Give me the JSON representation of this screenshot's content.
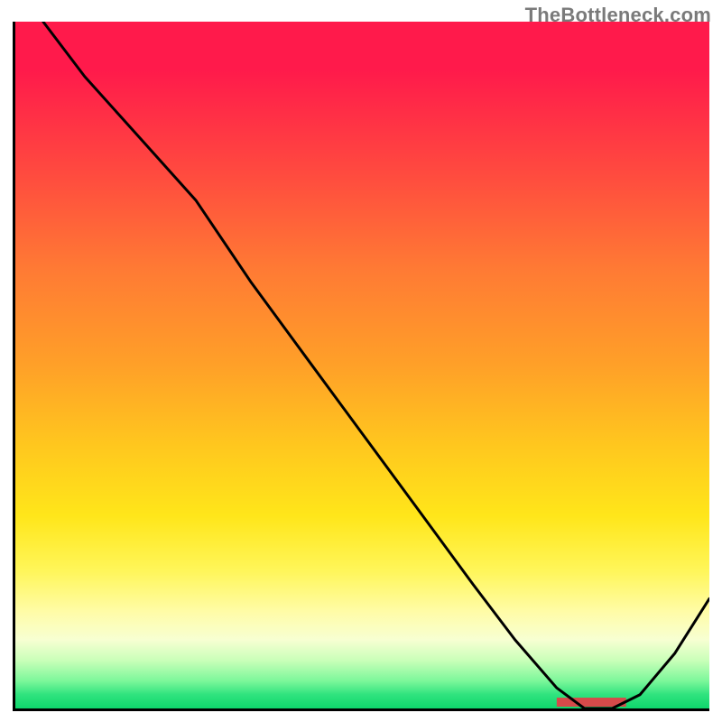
{
  "watermark": "TheBottleneck.com",
  "chart_data": {
    "type": "line",
    "title": "",
    "xlabel": "",
    "ylabel": "",
    "xlim": [
      0,
      100
    ],
    "ylim": [
      0,
      100
    ],
    "x": [
      4,
      10,
      18,
      26,
      34,
      42,
      50,
      58,
      66,
      72,
      78,
      82,
      86,
      90,
      95,
      100
    ],
    "values": [
      100,
      92,
      83,
      74,
      62,
      51,
      40,
      29,
      18,
      10,
      3,
      0,
      0,
      2,
      8,
      16
    ],
    "optimal_range_x": [
      78,
      88
    ],
    "grid": false,
    "legend": false,
    "colors": {
      "gradient_top": "#ff1a4b",
      "gradient_bottom": "#0fd66c",
      "curve": "#000000",
      "optimal_band": "#d54a4a"
    }
  }
}
